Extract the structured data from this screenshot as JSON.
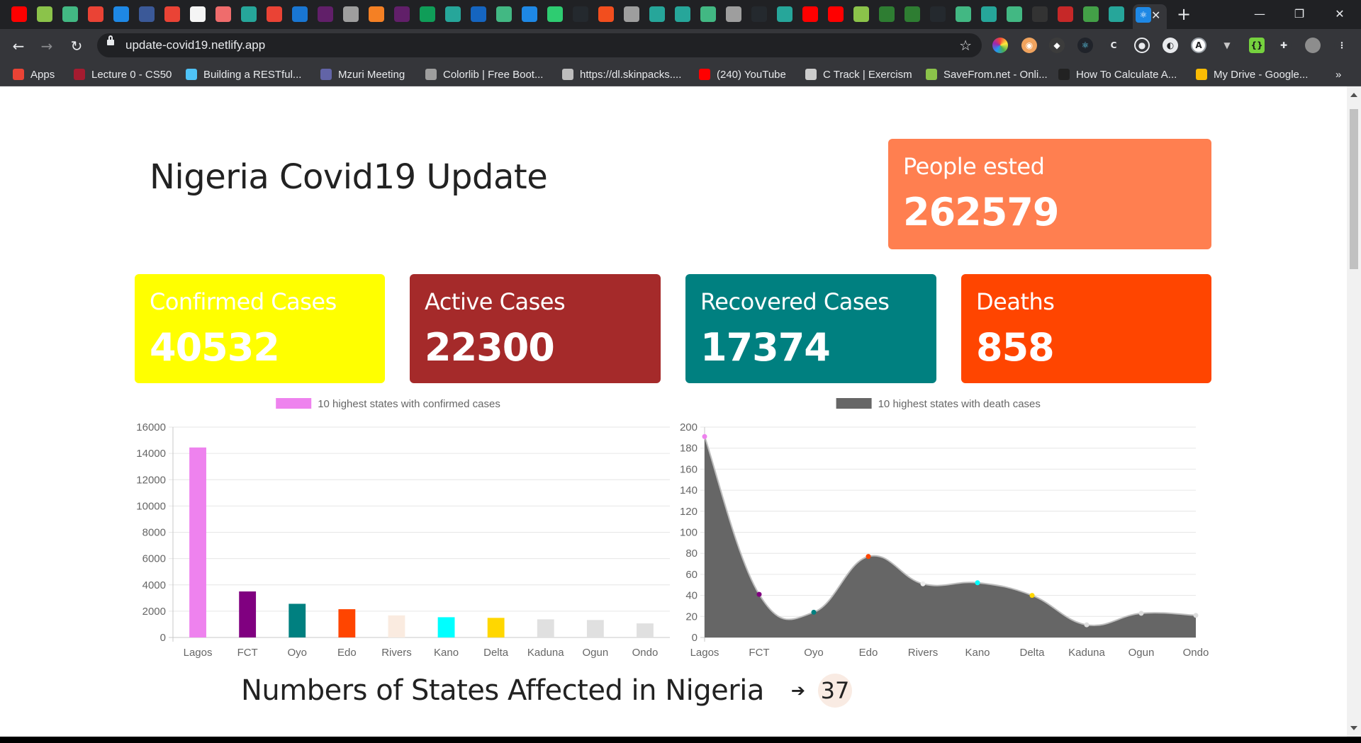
{
  "browser": {
    "active_tab": {
      "close_label": "✕"
    },
    "new_tab_label": "+",
    "window_controls": {
      "minimize": "—",
      "restore": "❐",
      "close": "✕"
    },
    "url": "update-covid19.netlify.app",
    "bookmarks": [
      {
        "label": "Apps",
        "color": "#ea4335"
      },
      {
        "label": "Lecture 0 - CS50",
        "color": "#a51c30"
      },
      {
        "label": "Building a RESTful...",
        "color": "#4fc3f7"
      },
      {
        "label": "Mzuri Meeting",
        "color": "#6264a7"
      },
      {
        "label": "Colorlib | Free Boot...",
        "color": "#9e9e9e"
      },
      {
        "label": "https://dl.skinpacks....",
        "color": "#bdbdbd"
      },
      {
        "label": "(240) YouTube",
        "color": "#ff0000"
      },
      {
        "label": "C Track | Exercism",
        "color": "#cccccc"
      },
      {
        "label": "SaveFrom.net - Onli...",
        "color": "#8bc34a"
      },
      {
        "label": "How To Calculate A...",
        "color": "#222222"
      },
      {
        "label": "My Drive - Google...",
        "color": "#fbbc04"
      }
    ],
    "bookmarks_overflow": "»"
  },
  "page": {
    "title": "Nigeria Covid19 Update",
    "tested": {
      "label": "People ested",
      "value": "262579",
      "color": "#ff7f50"
    },
    "cards": [
      {
        "label": "Confirmed Cases",
        "value": "40532",
        "color": "#ffff00"
      },
      {
        "label": "Active Cases",
        "value": "22300",
        "color": "#a52a2a"
      },
      {
        "label": "Recovered Cases",
        "value": "17374",
        "color": "#008080"
      },
      {
        "label": "Deaths",
        "value": "858",
        "color": "#ff4500"
      }
    ],
    "states_affected": {
      "label": "Numbers of States Affected in Nigeria",
      "arrow": "➔",
      "count": "37"
    }
  },
  "chart_data": [
    {
      "type": "bar",
      "legend": "10 highest states with confirmed cases",
      "legend_color": "#ee82ee",
      "categories": [
        "Lagos",
        "FCT",
        "Oyo",
        "Edo",
        "Rivers",
        "Kano",
        "Delta",
        "Kaduna",
        "Ogun",
        "Ondo"
      ],
      "values": [
        14450,
        3500,
        2560,
        2150,
        1680,
        1540,
        1490,
        1380,
        1330,
        1070
      ],
      "colors": [
        "#ee82ee",
        "#800080",
        "#008080",
        "#ff4500",
        "#faebe0",
        "#00ffff",
        "#ffd700",
        "#e0e0e0",
        "#e0e0e0",
        "#e0e0e0"
      ],
      "ylim": [
        0,
        16000
      ],
      "yticks": [
        0,
        2000,
        4000,
        6000,
        8000,
        10000,
        12000,
        14000,
        16000
      ],
      "grid": true
    },
    {
      "type": "area",
      "legend": "10 highest states with death cases",
      "legend_color": "#666666",
      "categories": [
        "Lagos",
        "FCT",
        "Oyo",
        "Edo",
        "Rivers",
        "Kano",
        "Delta",
        "Kaduna",
        "Ogun",
        "Ondo"
      ],
      "values": [
        191,
        41,
        24,
        77,
        51,
        52,
        40,
        12,
        23,
        21
      ],
      "point_colors": [
        "#ee82ee",
        "#800080",
        "#008080",
        "#ff4500",
        "#eeeeee",
        "#00ffff",
        "#ffd700",
        "#dddddd",
        "#dddddd",
        "#dddddd"
      ],
      "fill_color": "#666666",
      "ylim": [
        0,
        200
      ],
      "yticks": [
        0,
        20,
        40,
        60,
        80,
        100,
        120,
        140,
        160,
        180,
        200
      ],
      "grid": true
    }
  ]
}
